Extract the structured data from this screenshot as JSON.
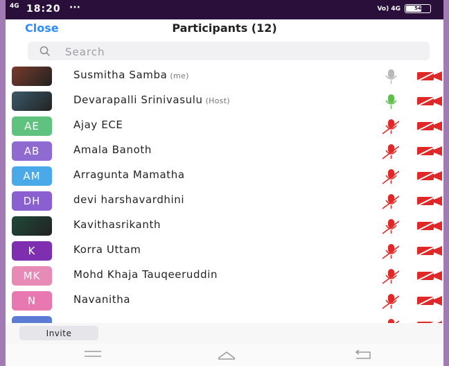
{
  "status_bar": {
    "network": "4G",
    "time": "18:20",
    "dots": "···",
    "right_network": "Vo) 4G",
    "battery": "54"
  },
  "header": {
    "close_label": "Close",
    "title": "Participants (12)"
  },
  "search": {
    "placeholder": "Search"
  },
  "participants": [
    {
      "initials": "",
      "name": "Susmitha Samba",
      "tag": "(me)",
      "avatar_type": "photo",
      "avatar_color": "#7a3a2a",
      "mic": "on"
    },
    {
      "initials": "",
      "name": "Devarapalli Srinivasulu",
      "tag": "(Host)",
      "avatar_type": "photo",
      "avatar_color": "#3b5a6a",
      "mic": "active"
    },
    {
      "initials": "AE",
      "name": "Ajay ECE",
      "tag": "",
      "avatar_type": "initials",
      "avatar_color": "#5fc27e",
      "mic": "muted"
    },
    {
      "initials": "AB",
      "name": "Amala Banoth",
      "tag": "",
      "avatar_type": "initials",
      "avatar_color": "#8f6ad1",
      "mic": "muted"
    },
    {
      "initials": "AM",
      "name": "Arragunta Mamatha",
      "tag": "",
      "avatar_type": "initials",
      "avatar_color": "#4aa9e8",
      "mic": "muted"
    },
    {
      "initials": "DH",
      "name": "devi harshavardhini",
      "tag": "",
      "avatar_type": "initials",
      "avatar_color": "#8a5fd0",
      "mic": "muted"
    },
    {
      "initials": "",
      "name": "Kavithasrikanth",
      "tag": "",
      "avatar_type": "photo",
      "avatar_color": "#1f4a3a",
      "mic": "muted"
    },
    {
      "initials": "K",
      "name": "Korra Uttam",
      "tag": "",
      "avatar_type": "initials",
      "avatar_color": "#7e2fb0",
      "mic": "muted"
    },
    {
      "initials": "MK",
      "name": "Mohd Khaja Tauqeeruddin",
      "tag": "",
      "avatar_type": "initials",
      "avatar_color": "#e78bb6",
      "mic": "muted"
    },
    {
      "initials": "N",
      "name": "Navanitha",
      "tag": "",
      "avatar_type": "initials",
      "avatar_color": "#e779b0",
      "mic": "muted"
    },
    {
      "initials": "",
      "name": "",
      "tag": "",
      "avatar_type": "initials",
      "avatar_color": "#5b7bd4",
      "mic": "muted"
    }
  ],
  "invite_label": "Invite",
  "colors": {
    "accent": "#2d8cff",
    "muted_red": "#e02828",
    "mic_active": "#5fbf4a",
    "mic_idle": "#b9b9b9"
  }
}
